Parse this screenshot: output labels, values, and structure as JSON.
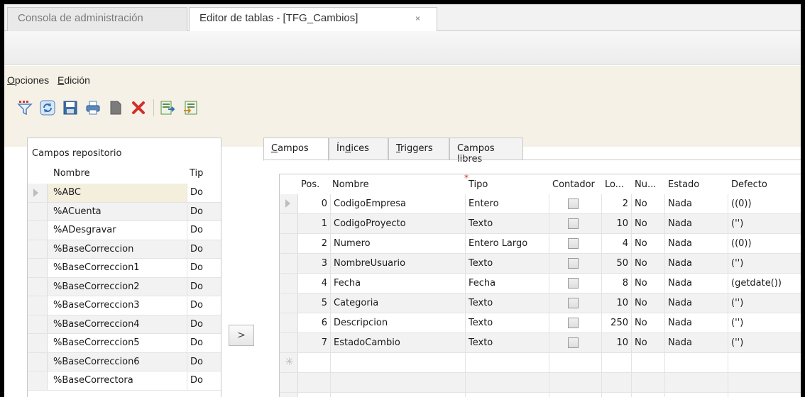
{
  "tabs": {
    "inactive_label": "Consola de administración",
    "active_label": "Editor de tablas - [TFG_Cambios]",
    "close_glyph": "×"
  },
  "menu": {
    "opciones": "Opciones",
    "edicion": "Edición"
  },
  "toolbar": {
    "buttons": [
      "filter-icon",
      "refresh-icon",
      "save-icon",
      "print-icon",
      "new-icon",
      "delete-icon",
      "export-icon",
      "import-icon"
    ]
  },
  "left_panel": {
    "title": "Campos repositorio",
    "col_nombre": "Nombre",
    "col_tipo": "Tip",
    "rows": [
      {
        "name": "%ABC",
        "type": "Do"
      },
      {
        "name": "%ACuenta",
        "type": "Do"
      },
      {
        "name": "%ADesgravar",
        "type": "Do"
      },
      {
        "name": "%BaseCorreccion",
        "type": "Do"
      },
      {
        "name": "%BaseCorreccion1",
        "type": "Do"
      },
      {
        "name": "%BaseCorreccion2",
        "type": "Do"
      },
      {
        "name": "%BaseCorreccion3",
        "type": "Do"
      },
      {
        "name": "%BaseCorreccion4",
        "type": "Do"
      },
      {
        "name": "%BaseCorreccion5",
        "type": "Do"
      },
      {
        "name": "%BaseCorreccion6",
        "type": "Do"
      },
      {
        "name": "%BaseCorrectora",
        "type": "Do"
      }
    ]
  },
  "move_button": ">",
  "right_tabs": {
    "campos": "Campos",
    "indices": "Índices",
    "triggers": "Triggers",
    "campos_libres": "Campos libres"
  },
  "grid": {
    "headers": {
      "pos": "Pos.",
      "nombre": "Nombre",
      "required_mark": "*",
      "tipo": "Tipo",
      "contador": "Contador",
      "longitud": "Lo...",
      "nulos": "Nu...",
      "estado": "Estado",
      "defecto": "Defecto"
    },
    "rows": [
      {
        "pos": "0",
        "name": "CodigoEmpresa",
        "type": "Entero",
        "len": "2",
        "null": "No",
        "state": "Nada",
        "default": "((0))"
      },
      {
        "pos": "1",
        "name": "CodigoProyecto",
        "type": "Texto",
        "len": "10",
        "null": "No",
        "state": "Nada",
        "default": "('')"
      },
      {
        "pos": "2",
        "name": "Numero",
        "type": "Entero Largo",
        "len": "4",
        "null": "No",
        "state": "Nada",
        "default": "((0))"
      },
      {
        "pos": "3",
        "name": "NombreUsuario",
        "type": "Texto",
        "len": "50",
        "null": "No",
        "state": "Nada",
        "default": "('')"
      },
      {
        "pos": "4",
        "name": "Fecha",
        "type": "Fecha",
        "len": "8",
        "null": "No",
        "state": "Nada",
        "default": "(getdate())"
      },
      {
        "pos": "5",
        "name": "Categoria",
        "type": "Texto",
        "len": "10",
        "null": "No",
        "state": "Nada",
        "default": "('')"
      },
      {
        "pos": "6",
        "name": "Descripcion",
        "type": "Texto",
        "len": "250",
        "null": "No",
        "state": "Nada",
        "default": "('')"
      },
      {
        "pos": "7",
        "name": "EstadoCambio",
        "type": "Texto",
        "len": "10",
        "null": "No",
        "state": "Nada",
        "default": "('')"
      }
    ],
    "new_row_glyph": "✳"
  }
}
